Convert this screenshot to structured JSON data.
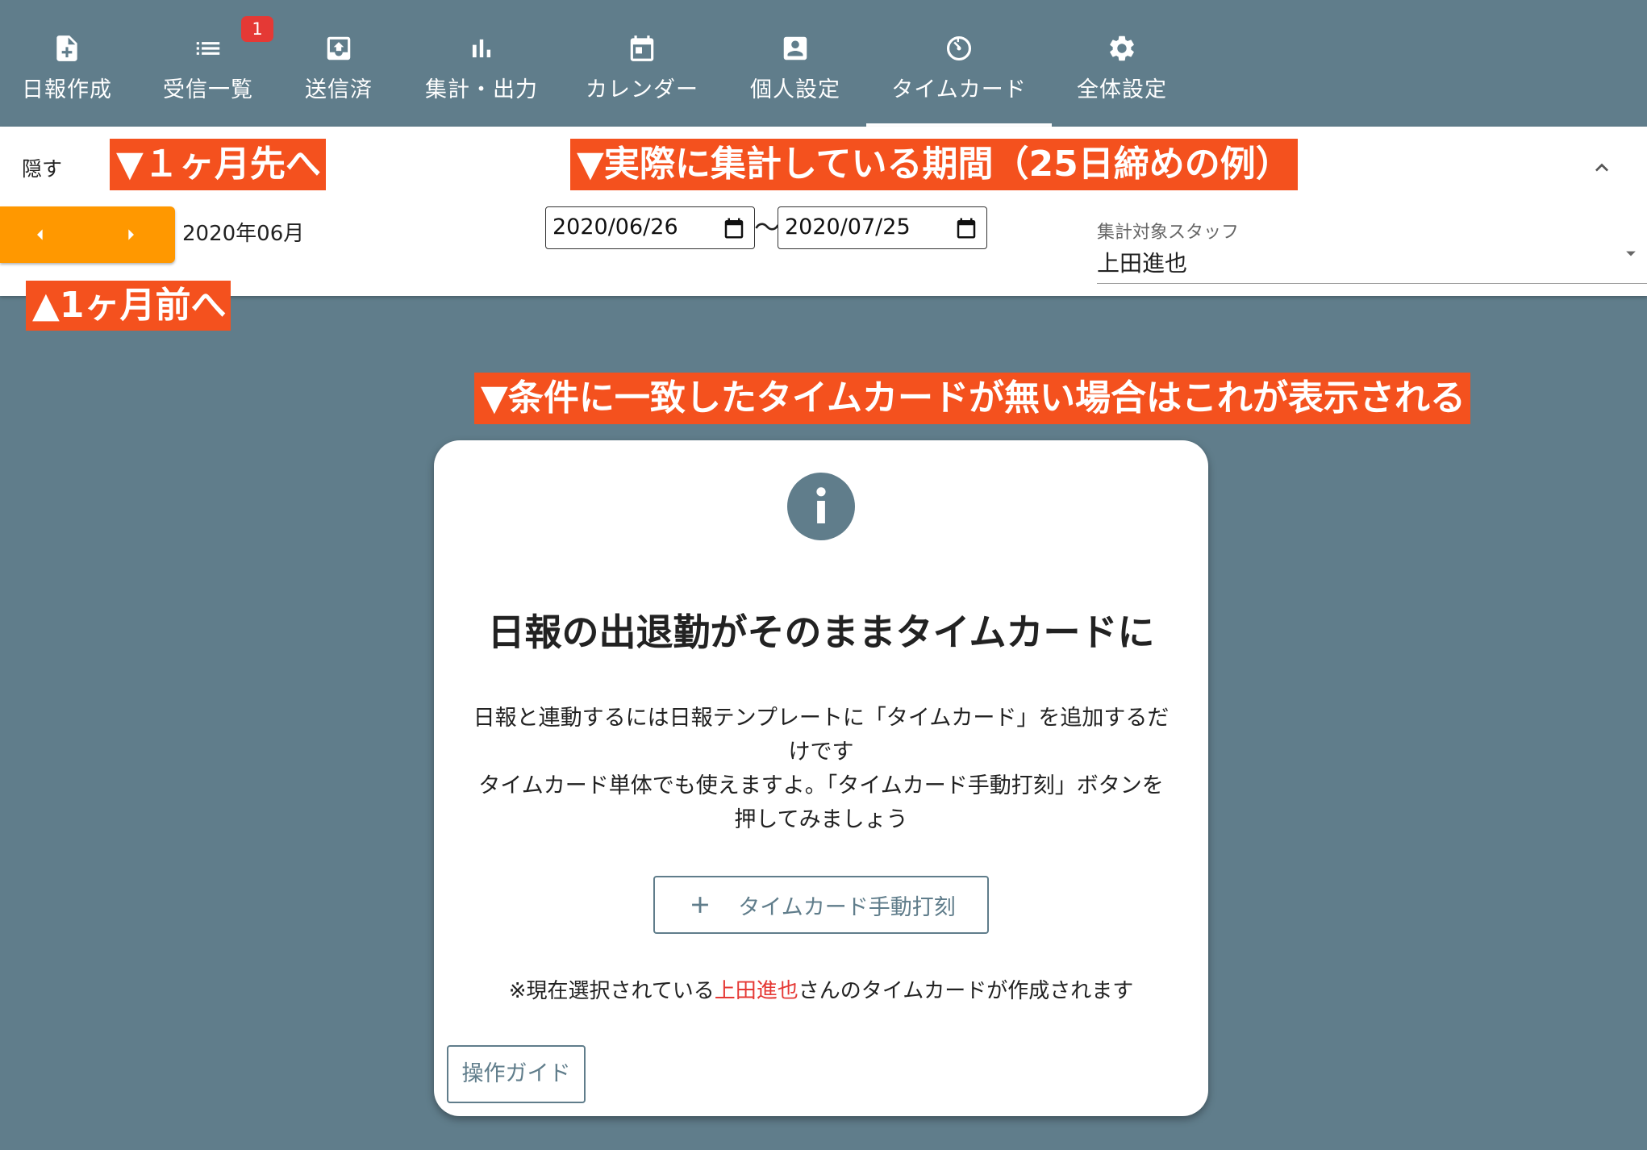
{
  "nav": {
    "items": [
      {
        "label": "日報作成",
        "icon": "file-plus-icon"
      },
      {
        "label": "受信一覧",
        "icon": "list-icon",
        "badge": "1"
      },
      {
        "label": "送信済",
        "icon": "outbox-upload-icon"
      },
      {
        "label": "集計・出力",
        "icon": "bar-chart-icon"
      },
      {
        "label": "カレンダー",
        "icon": "calendar-icon"
      },
      {
        "label": "個人設定",
        "icon": "account-box-icon"
      },
      {
        "label": "タイムカード",
        "icon": "timer-icon",
        "active": true
      },
      {
        "label": "全体設定",
        "icon": "gear-icon"
      }
    ]
  },
  "toolbar": {
    "hide_label": "隠す",
    "month_label": "2020年06月",
    "date_from": "2020/06/26",
    "date_to": "2020/07/25",
    "tilde": "〜",
    "staff_caption": "集計対象スタッフ",
    "staff_value": "上田進也"
  },
  "annotations": {
    "next_month": "▼１ヶ月先へ",
    "period": "▼実際に集計している期間（25日締めの例）",
    "prev_month": "▲1ヶ月前へ",
    "empty_state": "▼条件に一致したタイムカードが無い場合はこれが表示される"
  },
  "card": {
    "title": "日報の出退勤がそのままタイムカードに",
    "desc_line1": "日報と連動するには日報テンプレートに「タイムカード」を追加するだ",
    "desc_line2": "けです",
    "desc_line3": "タイムカード単体でも使えますよ。「タイムカード手動打刻」ボタンを",
    "desc_line4": "押してみましょう",
    "manual_button": "タイムカード手動打刻",
    "note_prefix": "※現在選択されている",
    "note_name": "上田進也",
    "note_suffix": "さんのタイムカードが作成されます",
    "guide_button": "操作ガイド"
  },
  "colors": {
    "primary": "#607d8b",
    "accent_orange": "#ff9800",
    "annotation": "#f4511e",
    "badge": "#e53935",
    "highlight_text": "#e53935"
  }
}
